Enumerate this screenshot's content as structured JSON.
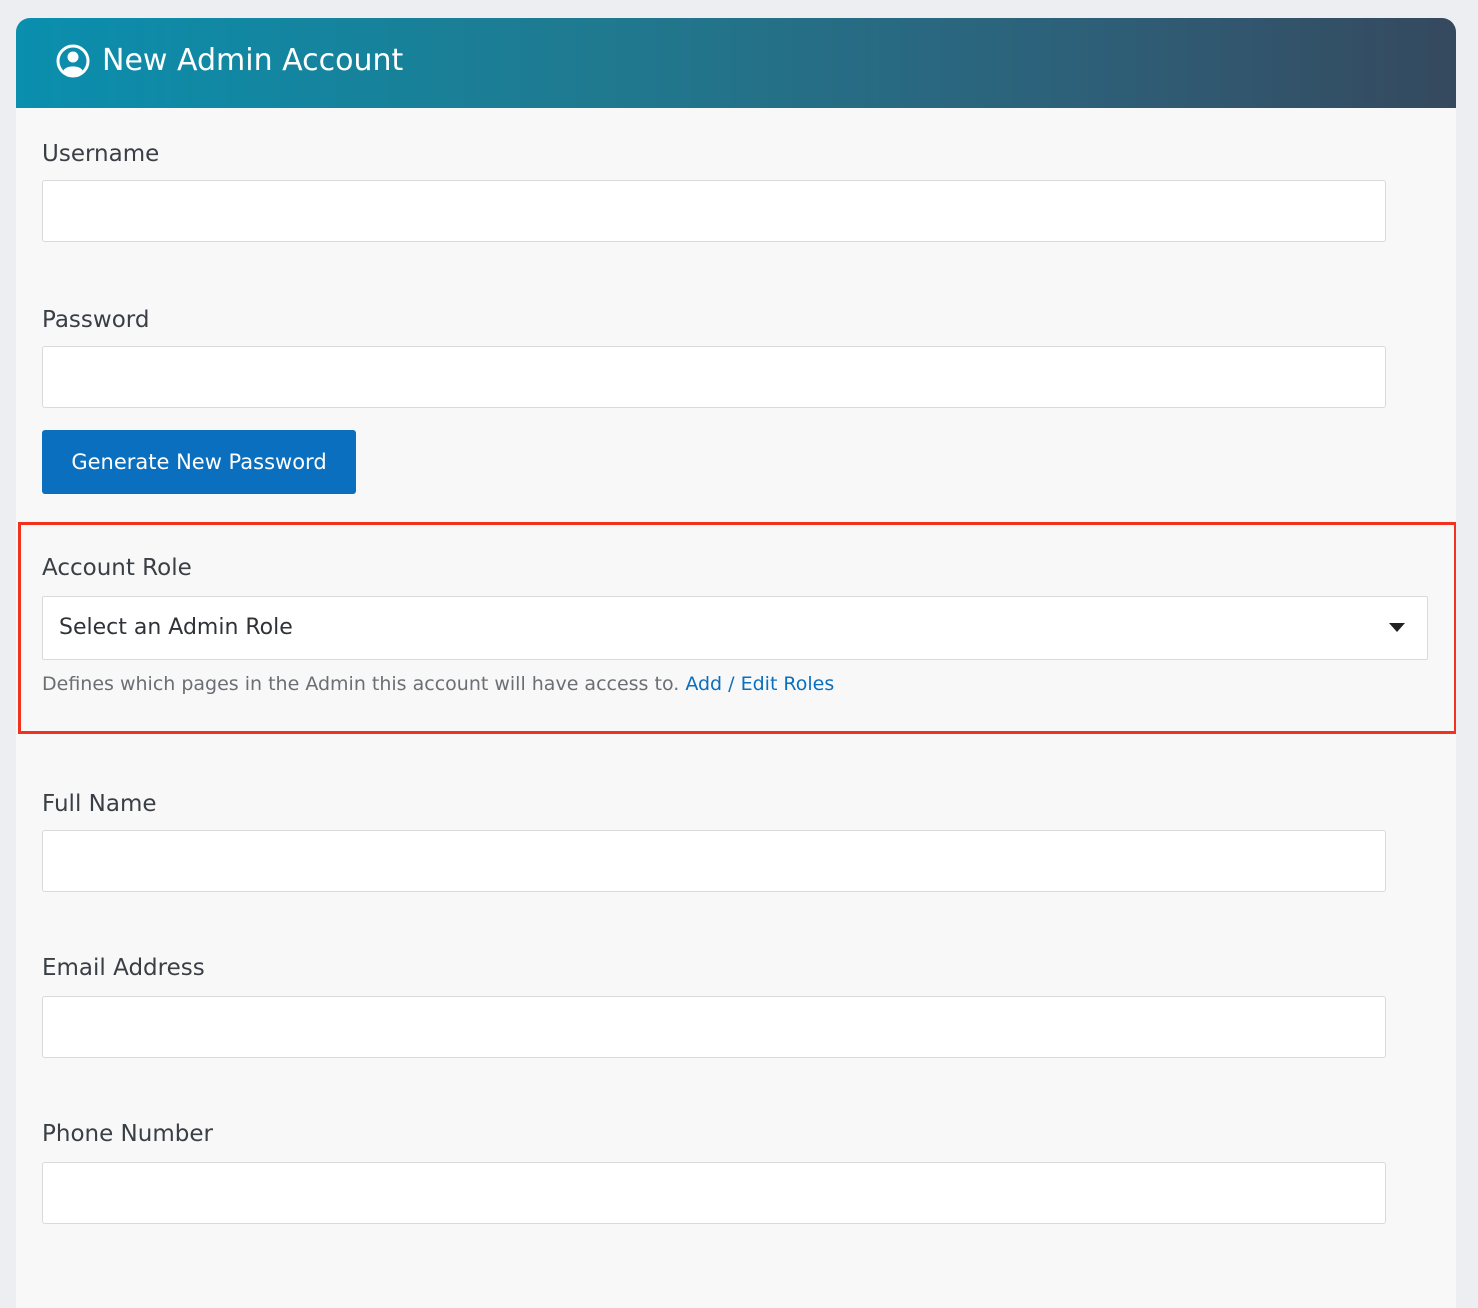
{
  "header": {
    "title": "New Admin Account",
    "icon": "user-circle-icon"
  },
  "form": {
    "username": {
      "label": "Username",
      "value": ""
    },
    "password": {
      "label": "Password",
      "value": ""
    },
    "generate_button_label": "Generate New Password",
    "account_role": {
      "label": "Account Role",
      "selected": "Select an Admin Role",
      "help_text": "Defines which pages in the Admin this account will have access to.",
      "help_link": "Add / Edit Roles"
    },
    "full_name": {
      "label": "Full Name",
      "value": ""
    },
    "email": {
      "label": "Email Address",
      "value": ""
    },
    "phone": {
      "label": "Phone Number",
      "value": ""
    }
  },
  "colors": {
    "header_gradient_start": "#0a8fae",
    "header_gradient_end": "#35495e",
    "primary_button": "#0a6fbe",
    "link": "#0a6fbe",
    "highlight_border": "#f0321e"
  }
}
